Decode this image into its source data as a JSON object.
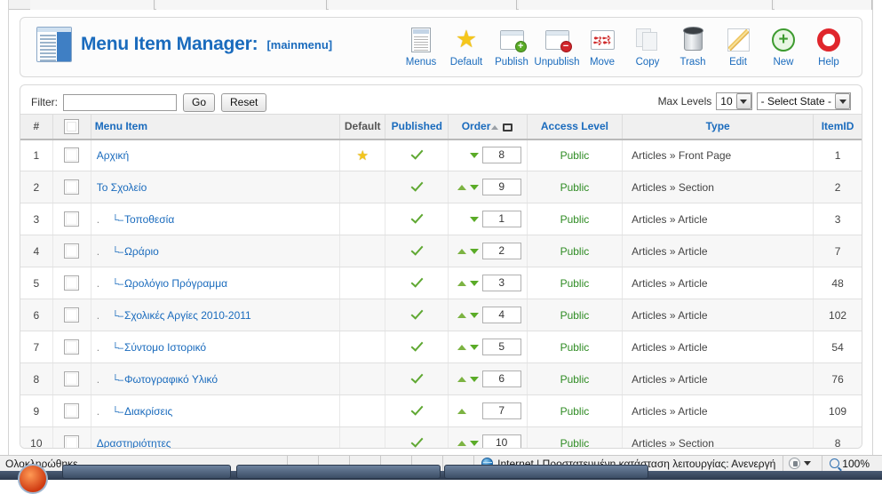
{
  "header": {
    "title": "Menu Item Manager:",
    "subtitle": "[mainmenu]",
    "icon": "menu-manager-icon"
  },
  "toolbar": {
    "items": [
      {
        "label": "Menus",
        "icon": "menus-icon"
      },
      {
        "label": "Default",
        "icon": "star-icon"
      },
      {
        "label": "Publish",
        "icon": "publish-icon"
      },
      {
        "label": "Unpublish",
        "icon": "unpublish-icon"
      },
      {
        "label": "Move",
        "icon": "move-icon"
      },
      {
        "label": "Copy",
        "icon": "copy-icon"
      },
      {
        "label": "Trash",
        "icon": "trash-icon"
      },
      {
        "label": "Edit",
        "icon": "edit-icon"
      },
      {
        "label": "New",
        "icon": "new-icon"
      },
      {
        "label": "Help",
        "icon": "help-icon"
      }
    ]
  },
  "filter": {
    "label": "Filter:",
    "value": "",
    "placeholder": "",
    "go_label": "Go",
    "reset_label": "Reset",
    "max_levels_label": "Max Levels",
    "max_levels_value": "10",
    "state_value": "- Select State -"
  },
  "table": {
    "headers": {
      "num": "#",
      "checkbox": "",
      "menu_item": "Menu Item",
      "default": "Default",
      "published": "Published",
      "order": "Order",
      "access_level": "Access Level",
      "type": "Type",
      "item_id": "ItemID"
    },
    "rows": [
      {
        "num": "1",
        "name": "Αρχική",
        "level": 0,
        "default": true,
        "published": true,
        "up": false,
        "down": true,
        "order": "8",
        "access": "Public",
        "type": "Articles » Front Page",
        "itemid": "1"
      },
      {
        "num": "2",
        "name": "Το Σχολείο",
        "level": 0,
        "default": false,
        "published": true,
        "up": true,
        "down": true,
        "order": "9",
        "access": "Public",
        "type": "Articles » Section",
        "itemid": "2"
      },
      {
        "num": "3",
        "name": "Τοποθεσία",
        "level": 1,
        "default": false,
        "published": true,
        "up": false,
        "down": true,
        "order": "1",
        "access": "Public",
        "type": "Articles » Article",
        "itemid": "3"
      },
      {
        "num": "4",
        "name": "Ωράριο",
        "level": 1,
        "default": false,
        "published": true,
        "up": true,
        "down": true,
        "order": "2",
        "access": "Public",
        "type": "Articles » Article",
        "itemid": "7"
      },
      {
        "num": "5",
        "name": "Ωρολόγιο Πρόγραμμα",
        "level": 1,
        "default": false,
        "published": true,
        "up": true,
        "down": true,
        "order": "3",
        "access": "Public",
        "type": "Articles » Article",
        "itemid": "48"
      },
      {
        "num": "6",
        "name": "Σχολικές Αργίες 2010-2011",
        "level": 1,
        "default": false,
        "published": true,
        "up": true,
        "down": true,
        "order": "4",
        "access": "Public",
        "type": "Articles » Article",
        "itemid": "102"
      },
      {
        "num": "7",
        "name": "Σύντομο Ιστορικό",
        "level": 1,
        "default": false,
        "published": true,
        "up": true,
        "down": true,
        "order": "5",
        "access": "Public",
        "type": "Articles » Article",
        "itemid": "54"
      },
      {
        "num": "8",
        "name": "Φωτογραφικό Υλικό",
        "level": 1,
        "default": false,
        "published": true,
        "up": true,
        "down": true,
        "order": "6",
        "access": "Public",
        "type": "Articles » Article",
        "itemid": "76"
      },
      {
        "num": "9",
        "name": "Διακρίσεις",
        "level": 1,
        "default": false,
        "published": true,
        "up": true,
        "down": false,
        "order": "7",
        "access": "Public",
        "type": "Articles » Article",
        "itemid": "109"
      },
      {
        "num": "10",
        "name": "Δραστηριότητες",
        "level": 0,
        "default": false,
        "published": true,
        "up": true,
        "down": true,
        "order": "10",
        "access": "Public",
        "type": "Articles » Section",
        "itemid": "8"
      }
    ]
  },
  "status_bar": {
    "text": "Ολοκληρώθηκε",
    "zone": "Internet | Προστατευμένη κατάσταση λειτουργίας: Ανενεργή",
    "zoom": "100%"
  }
}
